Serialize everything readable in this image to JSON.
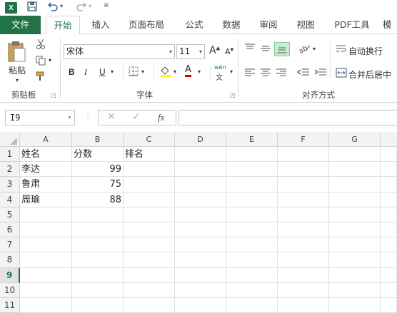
{
  "qat": {
    "app_logo": "X",
    "save_icon": "save-icon",
    "undo_icon": "undo-icon",
    "redo_icon": "redo-icon"
  },
  "tabs": [
    "文件",
    "开始",
    "插入",
    "页面布局",
    "公式",
    "数据",
    "审阅",
    "视图",
    "PDF工具",
    "模"
  ],
  "active_tab_index": 1,
  "ribbon": {
    "clipboard": {
      "paste_label": "粘贴",
      "group_label": "剪贴板"
    },
    "font": {
      "font_name": "宋体",
      "font_size": "11",
      "bold": "B",
      "italic": "I",
      "underline": "U",
      "grow": "A",
      "shrink": "A",
      "font_color": "A",
      "phonetic": "wén",
      "group_label": "字体"
    },
    "alignment": {
      "wrap_text": "自动换行",
      "merge_center": "合并后居中",
      "group_label": "对齐方式"
    }
  },
  "formula_bar": {
    "name_box": "I9",
    "fx": "fx",
    "formula": ""
  },
  "sheet": {
    "columns": [
      "A",
      "B",
      "C",
      "D",
      "E",
      "F",
      "G"
    ],
    "rows": [
      "1",
      "2",
      "3",
      "4",
      "5",
      "6",
      "7",
      "8",
      "9",
      "10",
      "11"
    ],
    "selected_row": 9,
    "cells": {
      "A1": "姓名",
      "B1": "分数",
      "C1": "排名",
      "A2": "李达",
      "B2": "99",
      "A3": "鲁肃",
      "B3": "75",
      "A4": "周瑜",
      "B4": "88"
    }
  },
  "colors": {
    "accent": "#217346",
    "paste_fill": "#c6efce"
  }
}
